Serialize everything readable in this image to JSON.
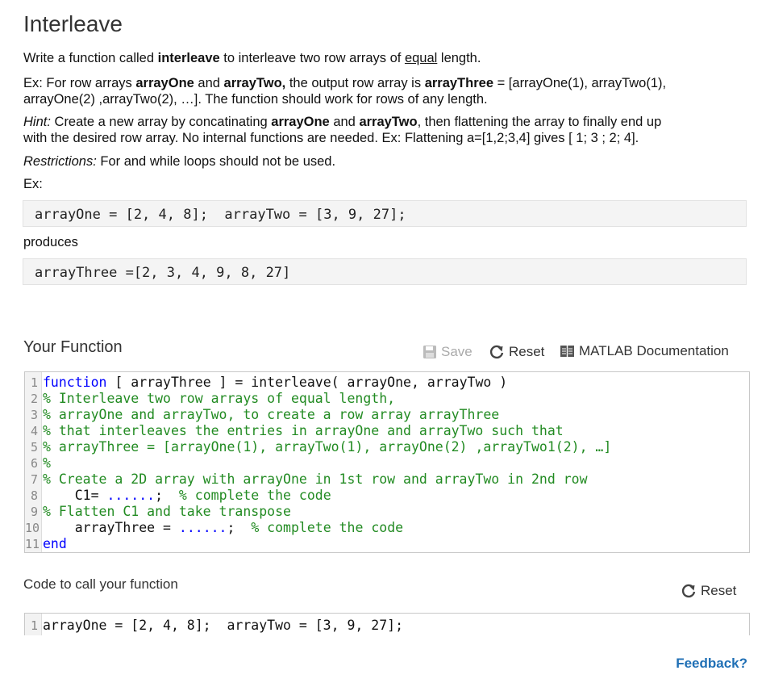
{
  "problem": {
    "title": "Interleave",
    "intro": {
      "pre": "Write a function called ",
      "bold": "interleave",
      "mid": " to interleave two row arrays of ",
      "underline": "equal",
      "post": " length."
    },
    "example_desc": {
      "l1_pre": "Ex: For row arrays ",
      "l1_b1": "arrayOne",
      "l1_mid": " and ",
      "l1_b2": "arrayTwo,",
      "l1_mid2": " the output row array is ",
      "l1_b3": "arrayThree",
      "l1_post": " = [arrayOne(1), arrayTwo(1),",
      "l2": "arrayOne(2) ,arrayTwo(2), …].  The function should work for rows of any length."
    },
    "hint": {
      "label": "Hint:",
      "l1_pre": " Create a new array by concatinating ",
      "l1_b1": "arrayOne",
      "l1_mid": " and ",
      "l1_b2": "arrayTwo",
      "l1_post": ", then flattening the array to finally end up",
      "l2": "with the desired row array.  No internal functions are needed. Ex: Flattening a=[1,2;3,4] gives [ 1; 3 ; 2; 4]."
    },
    "restrictions": {
      "label": "Restrictions:",
      "text": "  For and while loops should not be used."
    },
    "ex_label": "Ex:",
    "example_input": "arrayOne = [2, 4, 8];  arrayTwo = [3, 9, 27];",
    "produces_label": "produces",
    "example_output": "arrayThree =[2, 3, 4, 9, 8, 27]"
  },
  "your_function": {
    "title": "Your Function",
    "save_label": "Save",
    "reset_label": "Reset",
    "docs_label": "MATLAB Documentation",
    "code_lines": [
      {
        "num": "1",
        "parts": [
          {
            "t": "function",
            "c": "kw"
          },
          {
            "t": " [ arrayThree ] = interleave( arrayOne, arrayTwo )",
            "c": ""
          }
        ]
      },
      {
        "num": "2",
        "parts": [
          {
            "t": "% Interleave two row arrays of equal length,",
            "c": "cm"
          }
        ]
      },
      {
        "num": "3",
        "parts": [
          {
            "t": "% arrayOne and arrayTwo, to create a row array arrayThree",
            "c": "cm"
          }
        ]
      },
      {
        "num": "4",
        "parts": [
          {
            "t": "% that interleaves the entries in arrayOne and arrayTwo such that",
            "c": "cm"
          }
        ]
      },
      {
        "num": "5",
        "parts": [
          {
            "t": "% arrayThree = [arrayOne(1), arrayTwo(1), arrayOne(2) ,arrayTwo1(2), …]",
            "c": "cm"
          }
        ]
      },
      {
        "num": "6",
        "parts": [
          {
            "t": "%",
            "c": "cm"
          }
        ]
      },
      {
        "num": "7",
        "parts": [
          {
            "t": "% Create a 2D array with arrayOne in 1st row and arrayTwo in 2nd row",
            "c": "cm"
          }
        ]
      },
      {
        "num": "8",
        "parts": [
          {
            "t": "    C1= ",
            "c": ""
          },
          {
            "t": "......",
            "c": "kw"
          },
          {
            "t": ";  ",
            "c": ""
          },
          {
            "t": "% complete the code",
            "c": "cm"
          }
        ]
      },
      {
        "num": "9",
        "parts": [
          {
            "t": "% Flatten C1 and take transpose",
            "c": "cm"
          }
        ]
      },
      {
        "num": "10",
        "parts": [
          {
            "t": "    arrayThree = ",
            "c": ""
          },
          {
            "t": "......",
            "c": "kw"
          },
          {
            "t": ";  ",
            "c": ""
          },
          {
            "t": "% complete the code",
            "c": "cm"
          }
        ]
      },
      {
        "num": "11",
        "parts": [
          {
            "t": "end",
            "c": "kw"
          }
        ]
      }
    ]
  },
  "call_function": {
    "title": "Code to call your function",
    "reset_label": "Reset",
    "code_lines": [
      {
        "num": "1",
        "parts": [
          {
            "t": "arrayOne = [2, 4, 8];  arrayTwo = [3, 9, 27];",
            "c": ""
          }
        ]
      }
    ]
  },
  "feedback_label": "Feedback?",
  "colors": {
    "keyword": "#0000ff",
    "comment": "#228b22",
    "link": "#1f6fb5"
  },
  "icons": {
    "save": "floppy-disk-icon",
    "reset": "circular-arrow-icon",
    "docs": "book-icon"
  }
}
